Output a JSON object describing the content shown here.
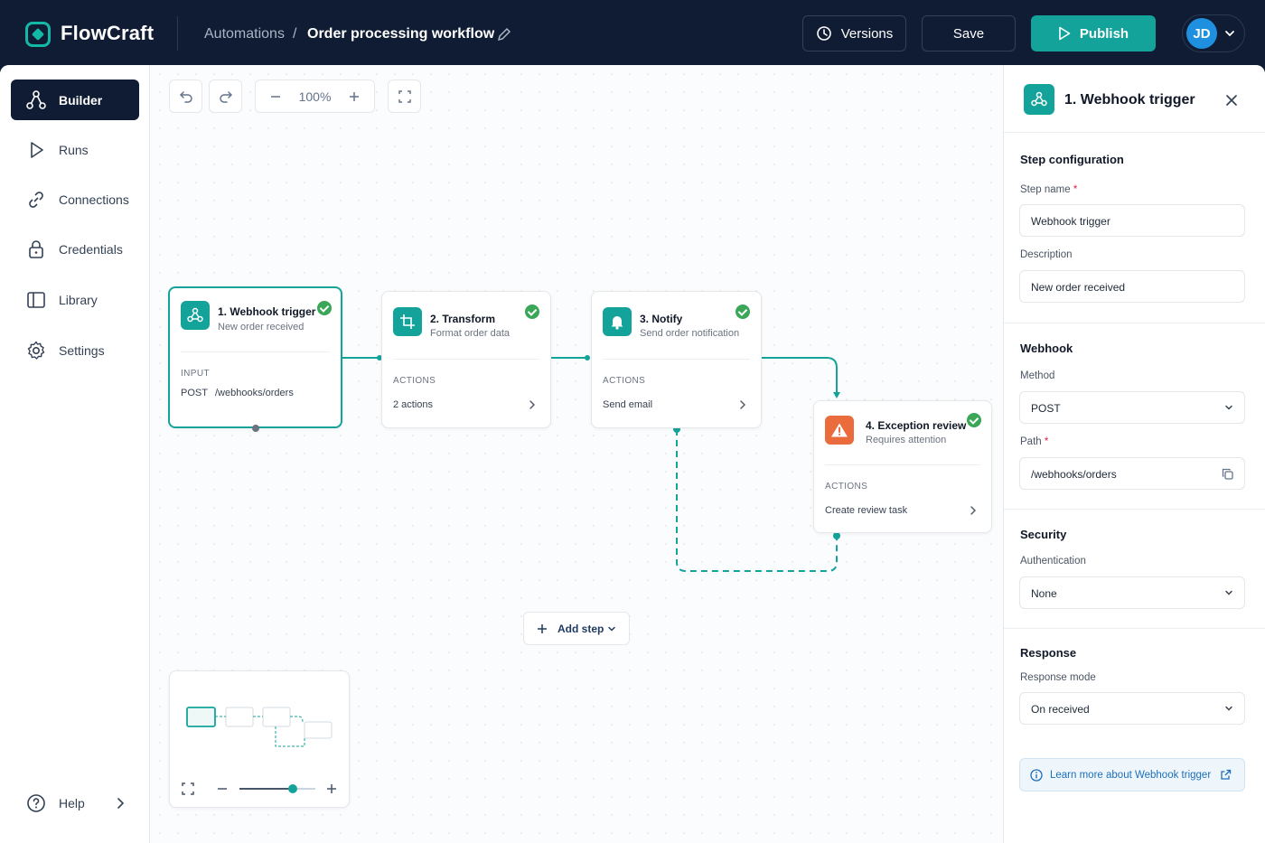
{
  "app": {
    "name": "FlowCraft"
  },
  "breadcrumb": {
    "parent": "Automations",
    "separator": "/",
    "current": "Order processing workflow"
  },
  "header": {
    "versions_label": "Versions",
    "save_label": "Save",
    "publish_label": "Publish",
    "avatar_initials": "JD"
  },
  "sidebar": {
    "items": [
      {
        "label": "Builder",
        "icon": "workflow-icon",
        "active": true
      },
      {
        "label": "Runs",
        "icon": "play-icon"
      },
      {
        "label": "Connections",
        "icon": "link-icon"
      },
      {
        "label": "Credentials",
        "icon": "lock-icon"
      },
      {
        "label": "Library",
        "icon": "book-icon"
      },
      {
        "label": "Settings",
        "icon": "gear-icon"
      }
    ],
    "help_label": "Help"
  },
  "toolbar": {
    "zoom": "100%"
  },
  "nodes": [
    {
      "title": "1. Webhook trigger",
      "subtitle": "New order received",
      "section": "INPUT",
      "method": "POST",
      "path": "/webhooks/orders",
      "status": "success",
      "selected": true
    },
    {
      "title": "2. Transform",
      "subtitle": "Format order data",
      "section": "ACTIONS",
      "value": "2 actions",
      "status": "success"
    },
    {
      "title": "3. Notify",
      "subtitle": "Send order notification",
      "section": "ACTIONS",
      "value": "Send email",
      "status": "success"
    },
    {
      "title": "4. Exception review",
      "subtitle": "Requires attention",
      "section": "ACTIONS",
      "value": "Create review task",
      "status": "success"
    }
  ],
  "canvas": {
    "add_step_label": "Add step",
    "minimap_zoom_level": 0.7
  },
  "panel": {
    "title": "1. Webhook trigger",
    "step_config": {
      "heading": "Step configuration",
      "name_label": "Step name",
      "required_mark": "*",
      "name_value": "Webhook trigger",
      "description_label": "Description",
      "description_value": "New order received"
    },
    "webhook": {
      "heading": "Webhook",
      "method_label": "Method",
      "method_value": "POST",
      "path_label": "Path",
      "path_value": "/webhooks/orders"
    },
    "security": {
      "heading": "Security",
      "auth_label": "Authentication",
      "auth_value": "None"
    },
    "response": {
      "heading": "Response",
      "mode_label": "Response mode",
      "mode_value": "On received"
    },
    "learn_more": "Learn more about Webhook trigger"
  },
  "colors": {
    "accent": "#14a39a",
    "header_bg": "#0f1c33",
    "success": "#3aa657",
    "warning": "#ea6b3c",
    "link": "#1d6fb8"
  }
}
